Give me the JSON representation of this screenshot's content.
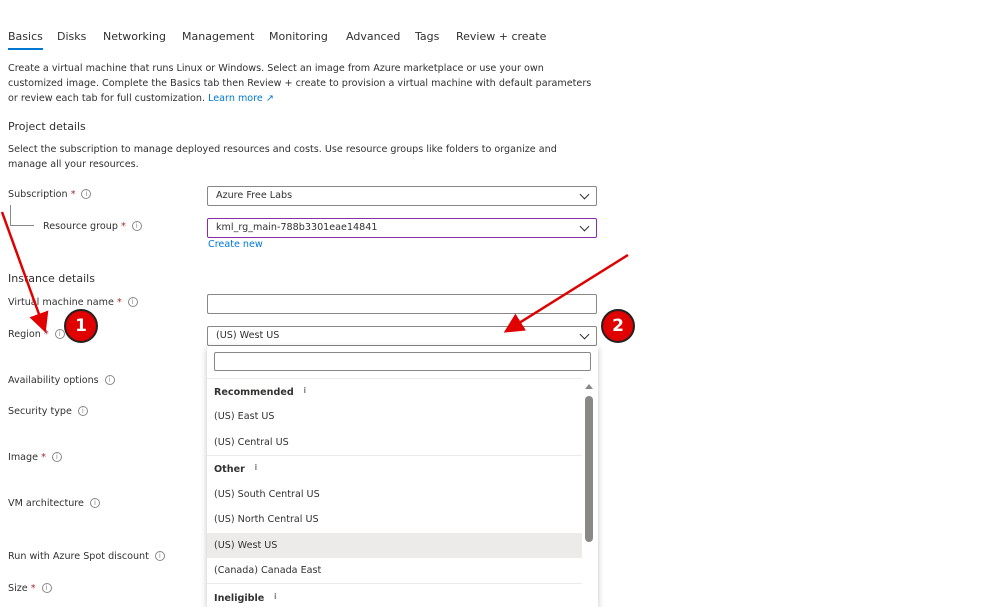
{
  "tabs": [
    "Basics",
    "Disks",
    "Networking",
    "Management",
    "Monitoring",
    "Advanced",
    "Tags",
    "Review + create"
  ],
  "intro": "Create a virtual machine that runs Linux or Windows. Select an image from Azure marketplace or use your own customized image. Complete the Basics tab then Review + create to provision a virtual machine with default parameters or review each tab for full customization.",
  "learn_more": "Learn more",
  "project": {
    "title": "Project details",
    "desc": "Select the subscription to manage deployed resources and costs. Use resource groups like folders to organize and manage all your resources.",
    "subscription_label": "Subscription",
    "subscription_value": "Azure Free Labs",
    "rg_label": "Resource group",
    "rg_value": "kml_rg_main-788b3301eae14841",
    "create_new": "Create new"
  },
  "instance": {
    "title": "Instance details",
    "vm_name_label": "Virtual machine name",
    "vm_name_value": "",
    "region_label": "Region",
    "region_value": "(US) West US",
    "availability_label": "Availability options",
    "security_label": "Security type",
    "image_label": "Image",
    "arch_label": "VM architecture",
    "spot_label": "Run with Azure Spot discount",
    "size_label": "Size"
  },
  "required_mark": "*",
  "info_glyph": "i",
  "region_dropdown": {
    "search_value": "",
    "groups": {
      "recommended": "Recommended",
      "other": "Other",
      "ineligible": "Ineligible"
    },
    "options": [
      "(US) East US",
      "(US) Central US",
      "(US) South Central US",
      "(US) North Central US",
      "(US) West US",
      "(Canada) Canada East"
    ],
    "selected": "(US) West US"
  },
  "annotations": [
    "1",
    "2"
  ],
  "colors": {
    "accent": "#0078d4",
    "annotation": "#e00000",
    "rg_border": "#8a2da5"
  }
}
